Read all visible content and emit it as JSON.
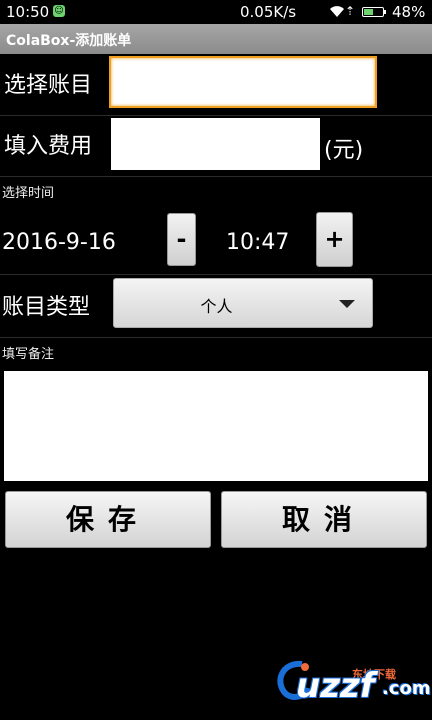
{
  "status_bar": {
    "time": "10:50",
    "network_speed": "0.05K/s",
    "battery": "48%",
    "battery_level": 0.48,
    "icons": [
      "notification-badge-icon",
      "wifi-icon",
      "upload-icon",
      "battery-icon"
    ]
  },
  "title_bar": {
    "title": "ColaBox-添加账单"
  },
  "form": {
    "account_label": "选择账目",
    "account_value": "",
    "cost_label": "填入费用",
    "cost_value": "",
    "cost_unit": "(元)",
    "time_label": "选择时间",
    "date": "2016-9-16",
    "time": "10:47",
    "minus_label": "-",
    "plus_label": "+",
    "type_label": "账目类型",
    "type_selected": "个人",
    "note_label": "填写备注",
    "note_value": ""
  },
  "actions": {
    "save": "保存",
    "cancel": "取消"
  },
  "watermark": {
    "brand": "uzzf",
    "tag": "东坡下载",
    "suffix": ".com"
  },
  "colors": {
    "focus": "#f0a020",
    "title_bar": "#999999",
    "background": "#000000"
  }
}
